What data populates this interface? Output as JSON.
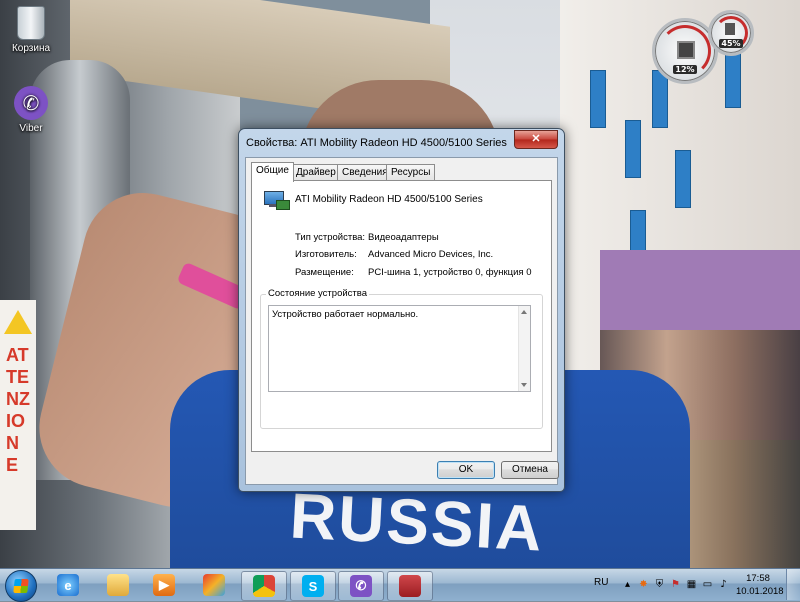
{
  "desktop": {
    "icons": [
      {
        "label": "Корзина"
      },
      {
        "label": "Viber"
      }
    ],
    "wallpaper_text": "ATTENZIONE",
    "shirt_text": "RUSSIA"
  },
  "gadget": {
    "cpu_percent": "12%",
    "memory_percent": "45%"
  },
  "dialog": {
    "title": "Свойства: ATI Mobility Radeon HD 4500/5100 Series",
    "close_glyph": "✕",
    "tabs": [
      {
        "label": "Общие",
        "active": true
      },
      {
        "label": "Драйвер",
        "active": false
      },
      {
        "label": "Сведения",
        "active": false
      },
      {
        "label": "Ресурсы",
        "active": false
      }
    ],
    "device_name": "ATI Mobility Radeon HD 4500/5100 Series",
    "properties": [
      {
        "key": "Тип устройства:",
        "value": "Видеоадаптеры"
      },
      {
        "key": "Изготовитель:",
        "value": "Advanced Micro Devices, Inc."
      },
      {
        "key": "Размещение:",
        "value": "PCI-шина 1, устройство 0, функция 0"
      }
    ],
    "status_group_label": "Состояние устройства",
    "status_text": "Устройство работает нормально.",
    "ok_label": "OK",
    "cancel_label": "Отмена"
  },
  "taskbar": {
    "pinned": [
      {
        "name": "Internet Explorer",
        "icon": "ie-icon",
        "running": false
      },
      {
        "name": "Explorer",
        "icon": "folder-icon",
        "running": false
      },
      {
        "name": "Media Player",
        "icon": "media-player-icon",
        "running": false
      },
      {
        "name": "Paint",
        "icon": "paint-icon",
        "running": false
      },
      {
        "name": "Google Chrome",
        "icon": "chrome-icon",
        "running": true
      },
      {
        "name": "Skype",
        "icon": "skype-icon",
        "running": true
      },
      {
        "name": "Viber",
        "icon": "viber-icon",
        "running": true
      },
      {
        "name": "Device Manager",
        "icon": "device-manager-icon",
        "running": true
      }
    ],
    "language": "RU",
    "time": "17:58",
    "date": "10.01.2018"
  }
}
